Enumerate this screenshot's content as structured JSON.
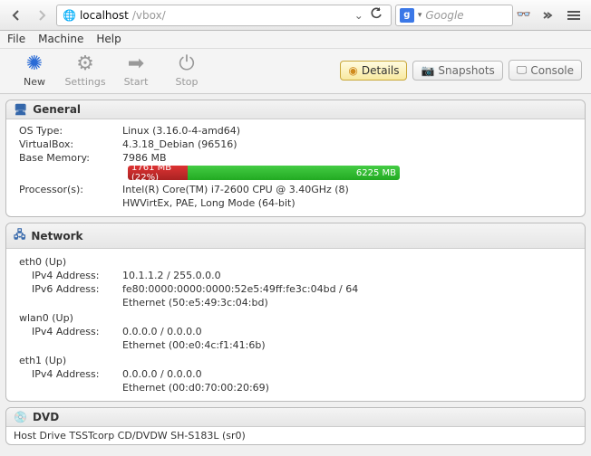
{
  "browser": {
    "url_host": "localhost",
    "url_path": "/vbox/",
    "search_engine": "g",
    "search_placeholder": "Google"
  },
  "menubar": [
    "File",
    "Machine",
    "Help"
  ],
  "actions": {
    "new": "New",
    "settings": "Settings",
    "start": "Start",
    "stop": "Stop"
  },
  "tabs": {
    "details": "Details",
    "snapshots": "Snapshots",
    "console": "Console"
  },
  "general": {
    "title": "General",
    "labels": {
      "os_type": "OS Type:",
      "virtualbox": "VirtualBox:",
      "base_memory": "Base Memory:",
      "processors": "Processor(s):"
    },
    "os_type": "Linux (3.16.0-4-amd64)",
    "virtualbox": "4.3.18_Debian (96516)",
    "base_memory": "7986 MB",
    "mem_used_text": "1761 MB (22%)",
    "mem_used_percent": 22,
    "mem_free_text": "6225 MB",
    "processor_line1": "Intel(R) Core(TM) i7-2600 CPU @ 3.40GHz (8)",
    "processor_line2": "HWVirtEx, PAE, Long Mode (64-bit)"
  },
  "network": {
    "title": "Network",
    "labels": {
      "ipv4": "IPv4 Address:",
      "ipv6": "IPv6 Address:"
    },
    "ifaces": [
      {
        "name": "eth0 (Up)",
        "ipv4": "10.1.1.2 / 255.0.0.0",
        "ipv6": "fe80:0000:0000:0000:52e5:49ff:fe3c:04bd / 64",
        "mac": "Ethernet (50:e5:49:3c:04:bd)"
      },
      {
        "name": "wlan0 (Up)",
        "ipv4": "0.0.0.0 / 0.0.0.0",
        "mac": "Ethernet (00:e0:4c:f1:41:6b)"
      },
      {
        "name": "eth1 (Up)",
        "ipv4": "0.0.0.0 / 0.0.0.0",
        "mac": "Ethernet (00:d0:70:00:20:69)"
      }
    ]
  },
  "dvd": {
    "title": "DVD",
    "drive": "Host Drive TSSTcorp CD/DVDW SH-S183L (sr0)"
  }
}
